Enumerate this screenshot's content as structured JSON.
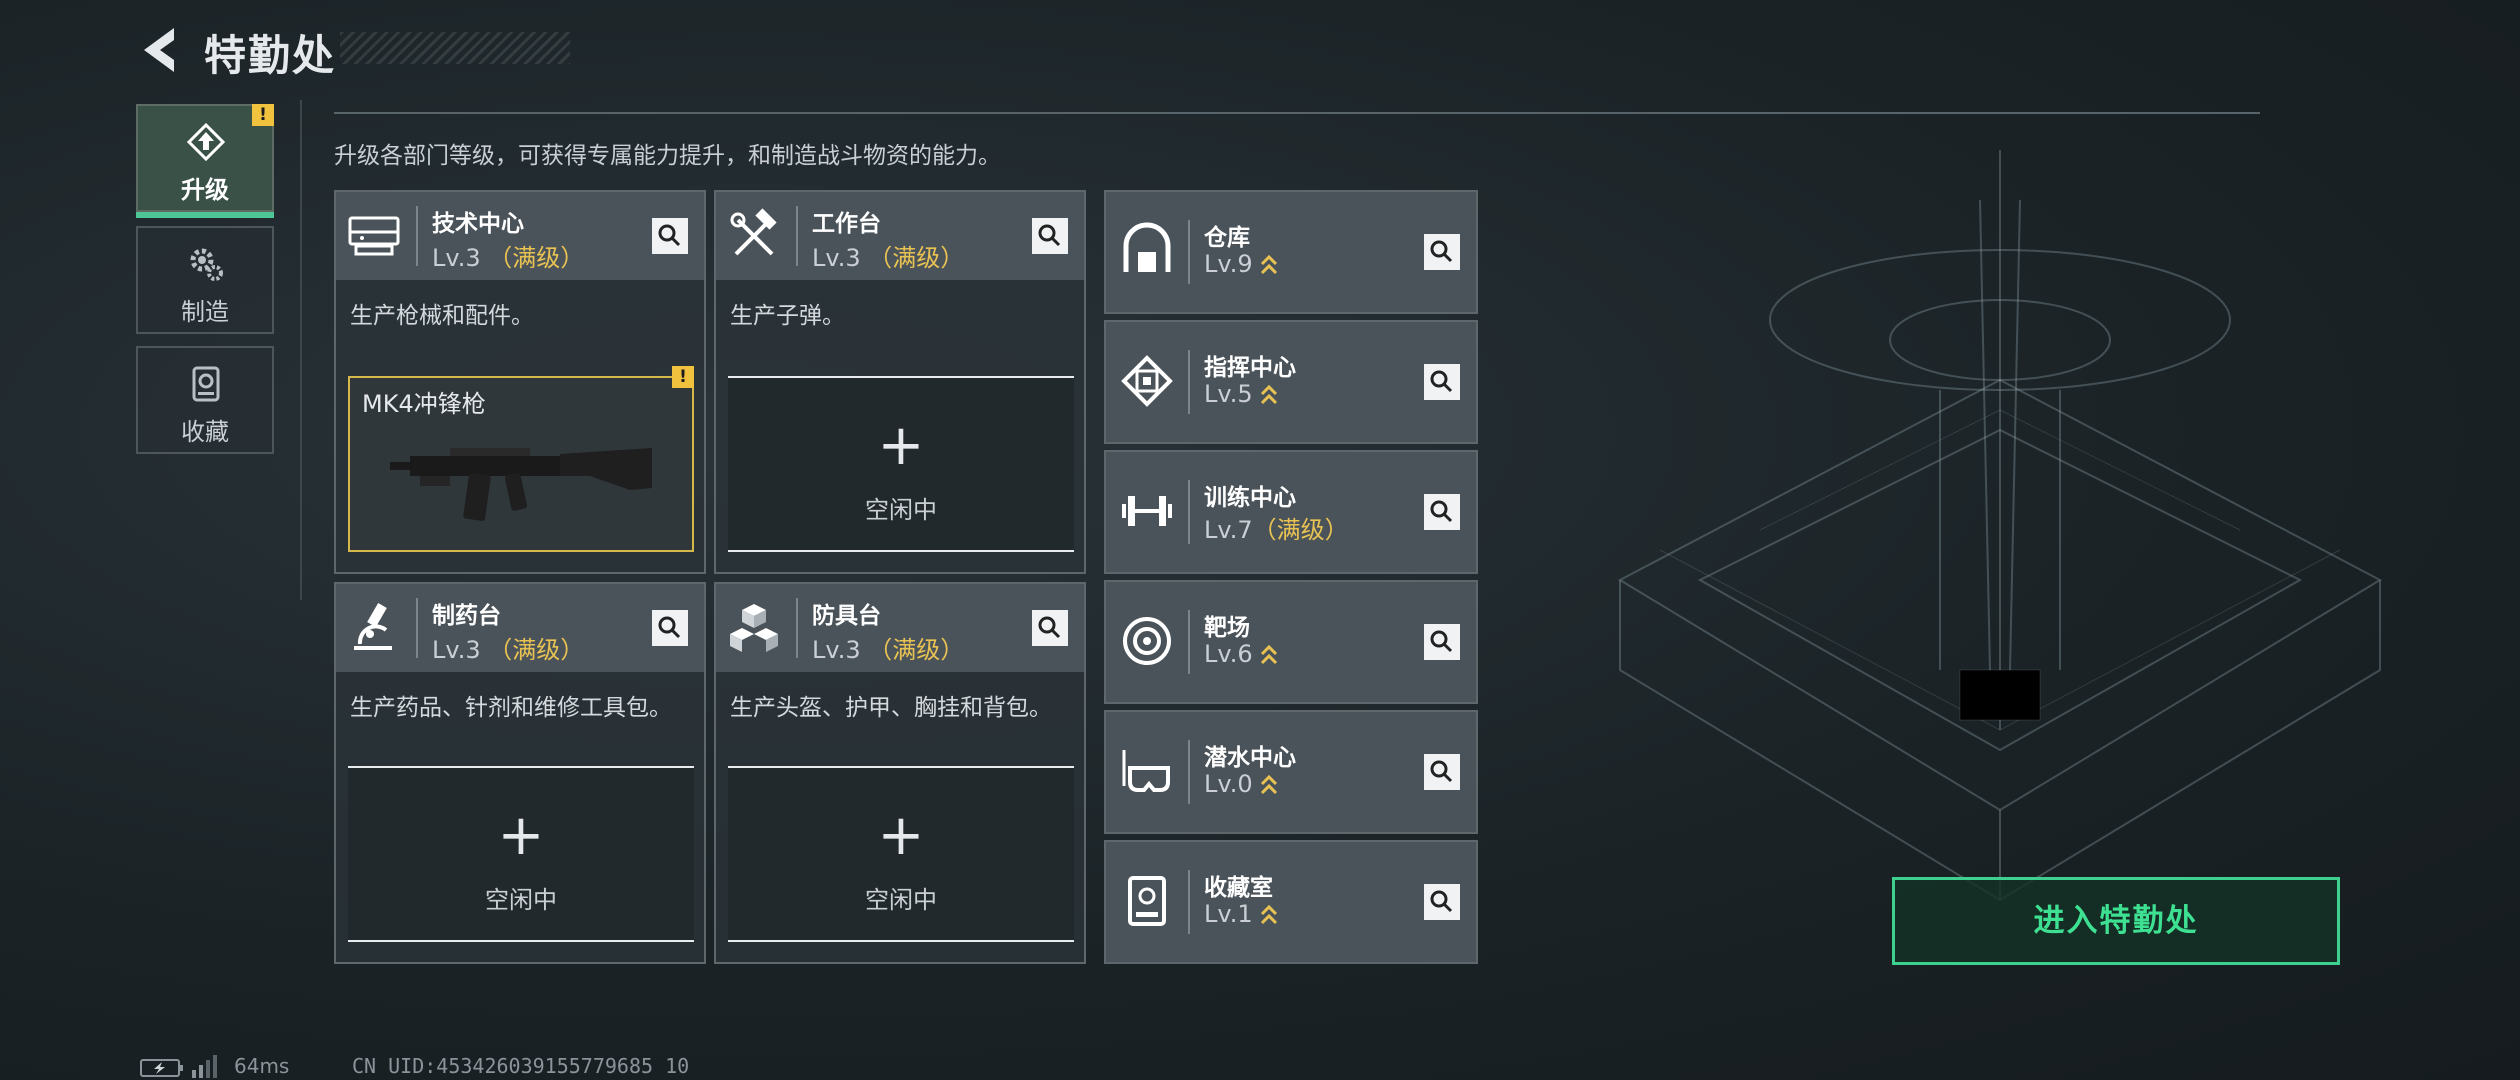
{
  "header": {
    "title": "特勤处"
  },
  "tabs": [
    {
      "label": "升级",
      "active": true,
      "alert": "!"
    },
    {
      "label": "制造",
      "active": false
    },
    {
      "label": "收藏",
      "active": false
    }
  ],
  "description": "升级各部门等级，可获得专属能力提升，和制造战斗物资的能力。",
  "production_buildings": [
    {
      "name": "技术中心",
      "level": "Lv.3",
      "max_tag": "（满级）",
      "desc": "生产枪械和配件。",
      "slot_item": "MK4冲锋枪",
      "slot_alert": "!"
    },
    {
      "name": "工作台",
      "level": "Lv.3",
      "max_tag": "（满级）",
      "desc": "生产子弹。",
      "slot_label": "空闲中"
    },
    {
      "name": "制药台",
      "level": "Lv.3",
      "max_tag": "（满级）",
      "desc": "生产药品、针剂和维修工具包。",
      "slot_label": "空闲中"
    },
    {
      "name": "防具台",
      "level": "Lv.3",
      "max_tag": "（满级）",
      "desc": "生产头盔、护甲、胸挂和背包。",
      "slot_label": "空闲中"
    }
  ],
  "facilities": [
    {
      "name": "仓库",
      "level": "Lv.9",
      "upgradable": true
    },
    {
      "name": "指挥中心",
      "level": "Lv.5",
      "upgradable": true
    },
    {
      "name": "训练中心",
      "level": "Lv.7",
      "max_tag": "（满级）"
    },
    {
      "name": "靶场",
      "level": "Lv.6",
      "upgradable": true
    },
    {
      "name": "潜水中心",
      "level": "Lv.0",
      "upgradable": true
    },
    {
      "name": "收藏室",
      "level": "Lv.1",
      "upgradable": true
    }
  ],
  "enter_button": {
    "label": "进入特勤处"
  },
  "footer": {
    "ping": "64ms",
    "uid": "CN UID:453426039155779685 10"
  },
  "colors": {
    "accent_green": "#3ed08e",
    "max_gold": "#e8c253",
    "alert_yellow": "#f0c23e"
  }
}
